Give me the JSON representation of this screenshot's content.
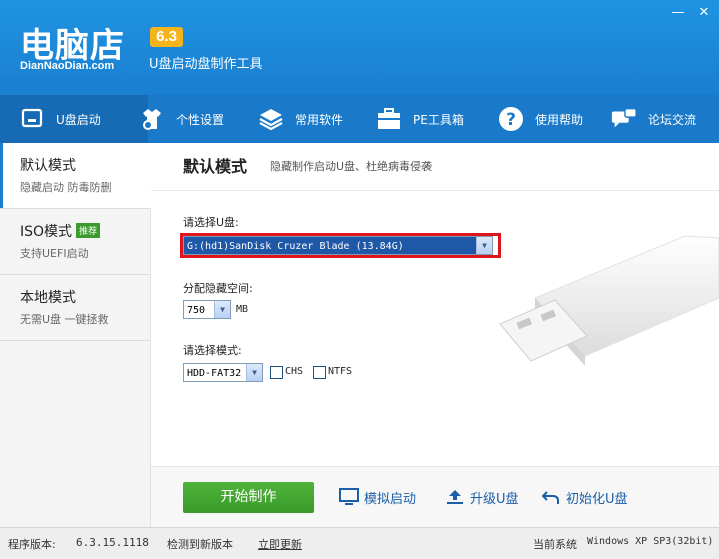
{
  "header": {
    "logo_text": "电脑店",
    "logo_sub": "DianNaoDian.com",
    "version_badge": "6.3",
    "tagline": "U盘启动盘制作工具"
  },
  "nav": {
    "items": [
      {
        "label": "U盘启动",
        "icon": "usb-drive-icon"
      },
      {
        "label": "个性设置",
        "icon": "shirt-gear-icon"
      },
      {
        "label": "常用软件",
        "icon": "stack-layers-icon"
      },
      {
        "label": "PE工具箱",
        "icon": "toolbox-icon"
      },
      {
        "label": "使用帮助",
        "icon": "help-icon"
      },
      {
        "label": "论坛交流",
        "icon": "chat-bubbles-icon"
      }
    ]
  },
  "sidebar": {
    "items": [
      {
        "title": "默认模式",
        "desc": "隐藏启动 防毒防删"
      },
      {
        "title": "ISO模式",
        "badge": "推荐",
        "desc": "支持UEFI启动"
      },
      {
        "title": "本地模式",
        "desc": "无需U盘 一键拯救"
      }
    ]
  },
  "main": {
    "title": "默认模式",
    "subtitle": "隐藏制作启动U盘、杜绝病毒侵袭",
    "select_drive_label": "请选择U盘:",
    "drive_value": "G:(hd1)SanDisk Cruzer Blade (13.84G)",
    "hidden_space_label": "分配隐藏空间:",
    "hidden_space_value": "750",
    "hidden_space_unit": "MB",
    "mode_label": "请选择模式:",
    "mode_value": "HDD-FAT32",
    "chs_label": "CHS",
    "ntfs_label": "NTFS"
  },
  "actions": {
    "start": "开始制作",
    "simulate": "模拟启动",
    "upgrade": "升级U盘",
    "init": "初始化U盘"
  },
  "status": {
    "version_label": "程序版本:",
    "version_value": "6.3.15.1118",
    "new_version": "检测到新版本",
    "update_now": "立即更新",
    "system_label": "当前系统",
    "system_value": "Windows XP SP3(32bit)"
  },
  "colors": {
    "header_blue": "#1f93e2",
    "nav_blue": "#1a79c8",
    "badge_orange": "#f5b51a",
    "start_green": "#3a9a2a",
    "highlight_red": "#e0141b"
  }
}
